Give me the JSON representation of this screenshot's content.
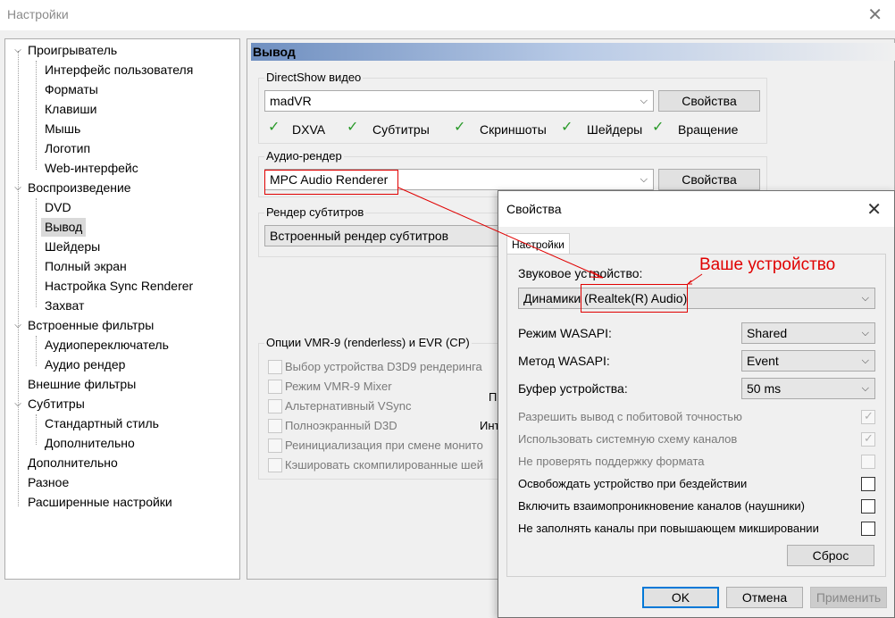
{
  "window": {
    "title": "Настройки",
    "close": "✕"
  },
  "tree": {
    "items": [
      {
        "label": "Проигрыватель"
      },
      {
        "label": "Интерфейс пользователя"
      },
      {
        "label": "Форматы"
      },
      {
        "label": "Клавиши"
      },
      {
        "label": "Мышь"
      },
      {
        "label": "Логотип"
      },
      {
        "label": "Web-интерфейс"
      },
      {
        "label": "Воспроизведение"
      },
      {
        "label": "DVD"
      },
      {
        "label": "Вывод"
      },
      {
        "label": "Шейдеры"
      },
      {
        "label": "Полный экран"
      },
      {
        "label": "Настройка Sync Renderer"
      },
      {
        "label": "Захват"
      },
      {
        "label": "Встроенные фильтры"
      },
      {
        "label": "Аудиопереключатель"
      },
      {
        "label": "Аудио рендер"
      },
      {
        "label": "Внешние фильтры"
      },
      {
        "label": "Субтитры"
      },
      {
        "label": "Стандартный стиль"
      },
      {
        "label": "Дополнительно"
      },
      {
        "label": "Дополнительно"
      },
      {
        "label": "Разное"
      },
      {
        "label": "Расширенные настройки"
      }
    ],
    "selected": "Вывод"
  },
  "panel": {
    "header": "Вывод",
    "directshow": {
      "label": "DirectShow видео",
      "value": "madVR",
      "props": "Свойства",
      "checks": [
        "DXVA",
        "Субтитры",
        "Скриншоты",
        "Шейдеры",
        "Вращение"
      ]
    },
    "audio": {
      "label": "Аудио-рендер",
      "value": "MPC Audio Renderer",
      "props": "Свойства"
    },
    "subs": {
      "label": "Рендер субтитров",
      "value": "Встроенный рендер субтитров"
    },
    "vmr": {
      "label": "Опции VMR-9 (renderless) и EVR (CP)",
      "options": [
        "Выбор устройства D3D9 рендеринга",
        "Режим VMR-9 Mixer",
        "Альтернативный VSync",
        "Полноэкранный D3D",
        "Реинициализация при смене монито",
        "Кэшировать скомпилированные шей"
      ],
      "frag1": "П",
      "frag2": "Инт"
    }
  },
  "dialog": {
    "title": "Свойства",
    "close": "✕",
    "tab": "Настройки",
    "device_label": "Звуковое устройство:",
    "device_value": "Динамики (Realtek(R) Audio)",
    "annotation": "Ваше устройство",
    "wasapi_mode_label": "Режим WASAPI:",
    "wasapi_mode_value": "Shared",
    "wasapi_method_label": "Метод WASAPI:",
    "wasapi_method_value": "Event",
    "buffer_label": "Буфер устройства:",
    "buffer_value": "50 ms",
    "options": [
      {
        "label": "Разрешить вывод с побитовой точностью",
        "enabled": false,
        "checked": true
      },
      {
        "label": "Использовать системную схему каналов",
        "enabled": false,
        "checked": true
      },
      {
        "label": "Не проверять поддержку формата",
        "enabled": false,
        "checked": false
      },
      {
        "label": "Освобождать устройство при бездействии",
        "enabled": true,
        "checked": false
      },
      {
        "label": "Включить взаимопроникновение каналов (наушники)",
        "enabled": true,
        "checked": false
      },
      {
        "label": "Не заполнять каналы при повышающем микшировании",
        "enabled": true,
        "checked": false
      }
    ],
    "reset": "Сброс",
    "ok": "OK",
    "cancel": "Отмена",
    "apply": "Применить"
  },
  "colors": {
    "annotation": "#e00000",
    "accent": "#0078d7",
    "check_green": "#2a9a2a"
  }
}
